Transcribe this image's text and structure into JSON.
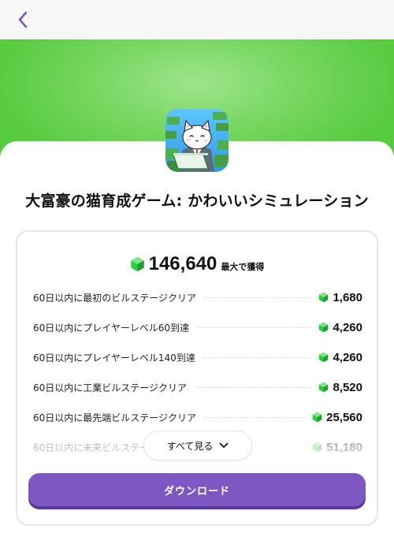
{
  "app": {
    "title": "大富豪の猫育成ゲーム: かわいいシミュレーション",
    "icon": "cat-businessman-app-icon"
  },
  "nav": {
    "back_icon": "chevron-left-icon"
  },
  "colors": {
    "accent": "#7e57c2",
    "hero_green": "#6fd45a",
    "gem_green": "#2ecc40"
  },
  "reward_total": {
    "value": "146,640",
    "label": "最大で獲得",
    "icon": "gem-icon"
  },
  "milestones": [
    {
      "label": "60日以内に最初のビルステージクリア",
      "value": "1,680"
    },
    {
      "label": "60日以内にプレイヤーレベル60到達",
      "value": "4,260"
    },
    {
      "label": "60日以内にプレイヤーレベル140到達",
      "value": "4,260"
    },
    {
      "label": "60日以内に工業ビルステージクリア",
      "value": "8,520"
    },
    {
      "label": "60日以内に最先端ビルステージクリア",
      "value": "25,560"
    },
    {
      "label": "60日以内に未来ビルステージクリア",
      "value": "51,180"
    }
  ],
  "see_all": {
    "label": "すべて見る",
    "icon": "chevron-down-icon"
  },
  "download": {
    "label": "ダウンロード"
  }
}
